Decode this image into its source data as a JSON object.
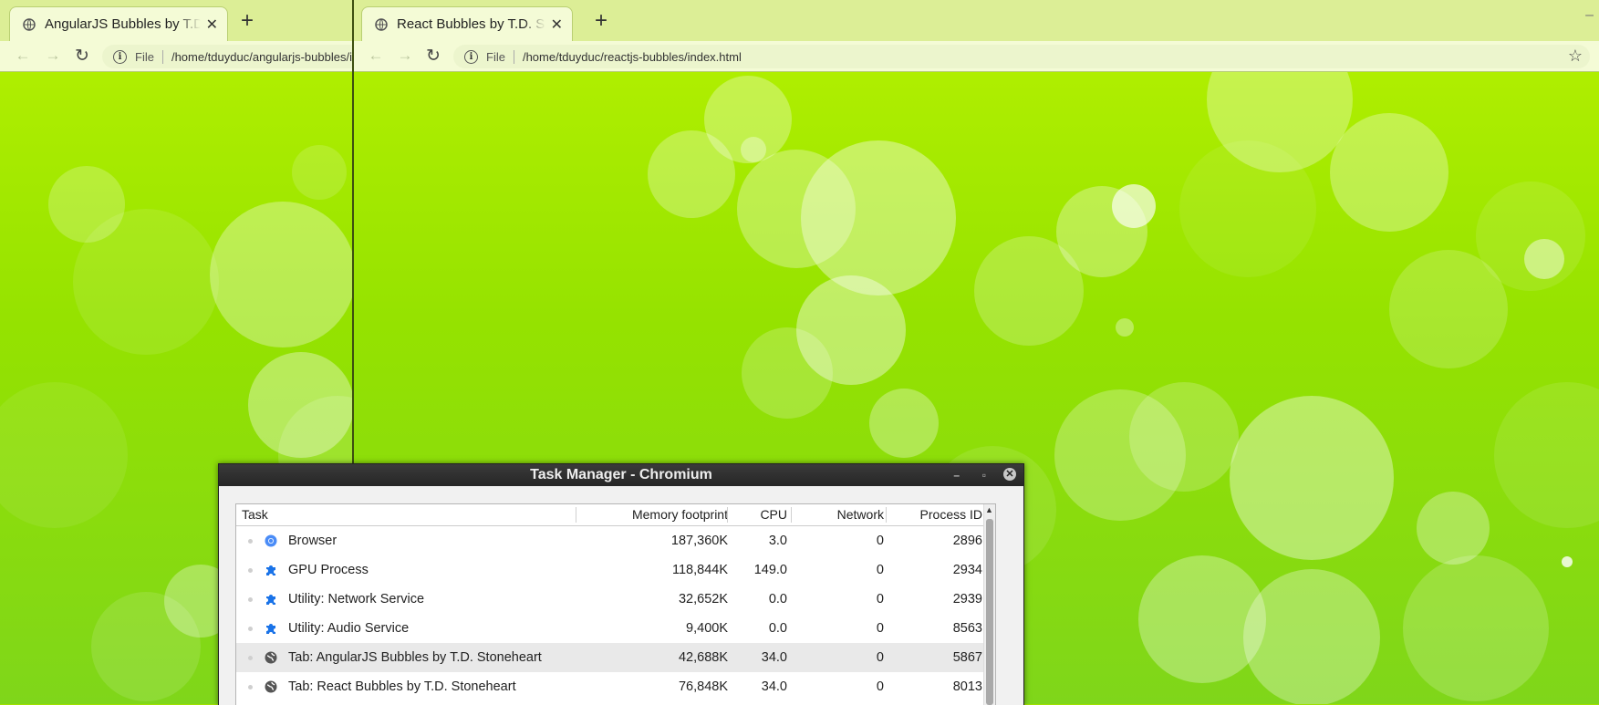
{
  "colors": {
    "page_bg": "#9ee000",
    "tab_bg": "#f4fbd6",
    "titlebar": "#2d2d2d"
  },
  "windows": {
    "angular": {
      "tab_title": "AngularJS Bubbles by T.D. Stoneheart",
      "url_scheme": "File",
      "url": "/home/tduyduc/angularjs-bubbles/index.html"
    },
    "react": {
      "tab_title": "React Bubbles by T.D. Stoneheart",
      "url_scheme": "File",
      "url": "/home/tduyduc/reactjs-bubbles/index.html"
    }
  },
  "icons": {
    "back": "←",
    "forward": "→",
    "reload": "↻",
    "close": "✕",
    "new_tab": "+",
    "star": "☆",
    "minimize": "–"
  },
  "task_manager": {
    "title": "Task Manager - Chromium",
    "columns": {
      "task": "Task",
      "memory": "Memory footprint",
      "cpu": "CPU",
      "network": "Network",
      "pid": "Process ID"
    },
    "rows": [
      {
        "icon": "chromium-icon",
        "task": "Browser",
        "memory": "187,360K",
        "cpu": "3.0",
        "network": "0",
        "pid": "2896"
      },
      {
        "icon": "puzzle-icon",
        "task": "GPU Process",
        "memory": "118,844K",
        "cpu": "149.0",
        "network": "0",
        "pid": "2934"
      },
      {
        "icon": "puzzle-icon",
        "task": "Utility: Network Service",
        "memory": "32,652K",
        "cpu": "0.0",
        "network": "0",
        "pid": "2939"
      },
      {
        "icon": "puzzle-icon",
        "task": "Utility: Audio Service",
        "memory": "9,400K",
        "cpu": "0.0",
        "network": "0",
        "pid": "8563"
      },
      {
        "icon": "globe-icon",
        "task": "Tab: AngularJS Bubbles by T.D. Stoneheart",
        "memory": "42,688K",
        "cpu": "34.0",
        "network": "0",
        "pid": "5867",
        "selected": true
      },
      {
        "icon": "globe-icon",
        "task": "Tab: React Bubbles by T.D. Stoneheart",
        "memory": "76,848K",
        "cpu": "34.0",
        "network": "0",
        "pid": "8013"
      }
    ]
  }
}
